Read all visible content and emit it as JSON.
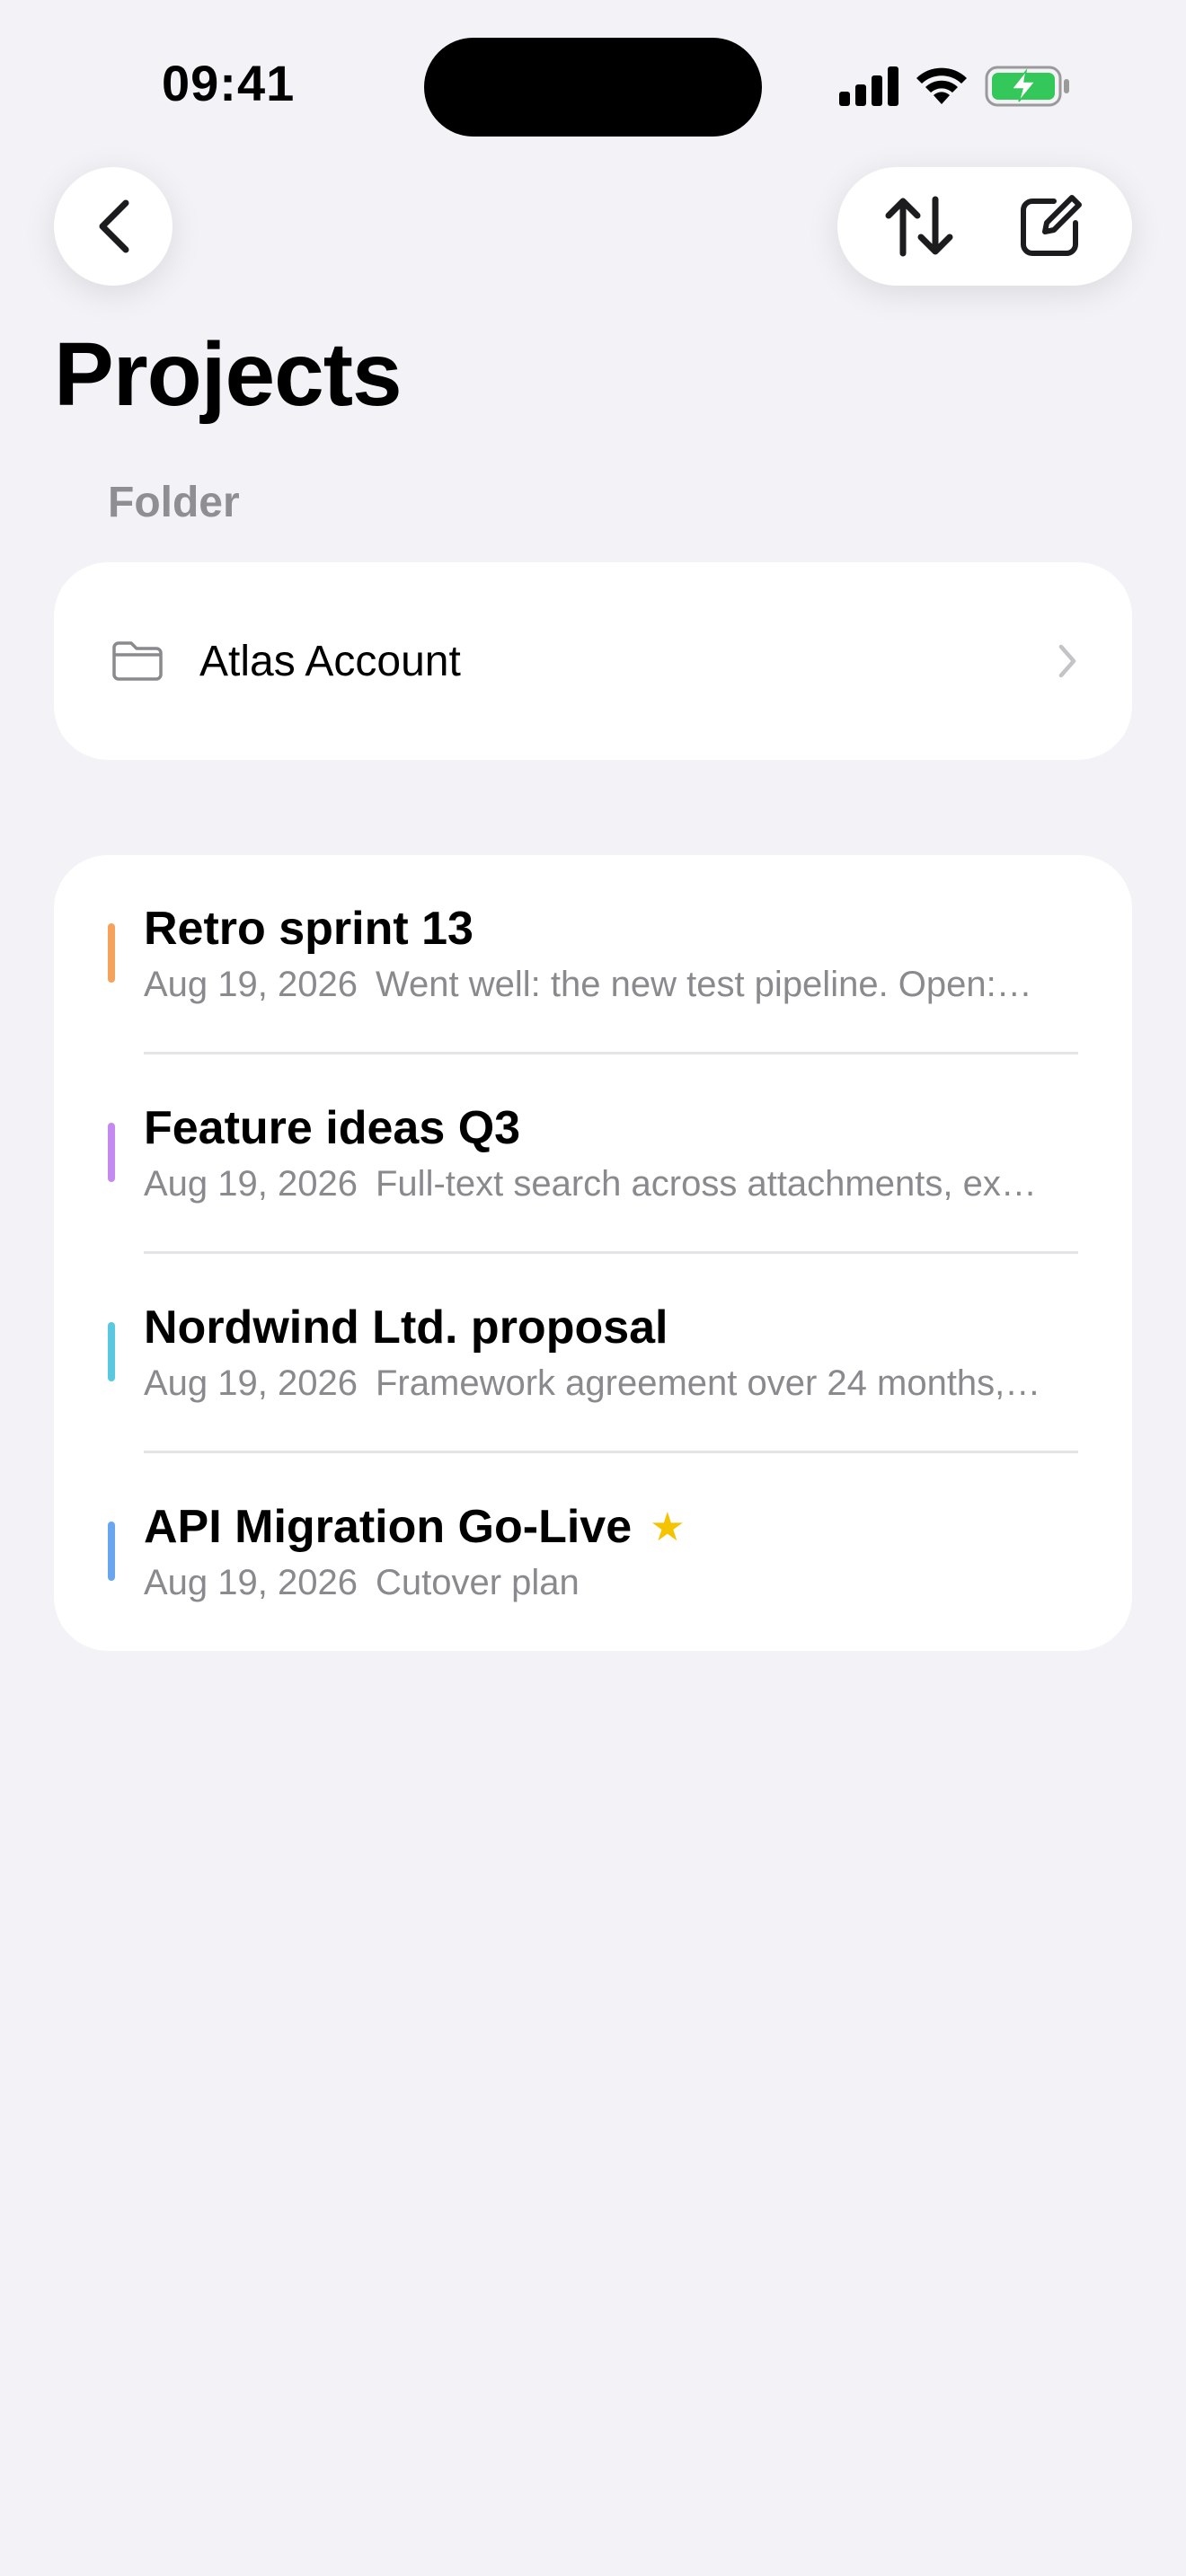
{
  "status_bar": {
    "time": "09:41"
  },
  "nav": {
    "back_icon": "chevron-left-icon",
    "sort_icon": "sort-arrows-icon",
    "compose_icon": "compose-icon"
  },
  "page": {
    "title": "Projects"
  },
  "folder_section": {
    "label": "Folder",
    "folder": {
      "icon": "folder-icon",
      "name": "Atlas Account"
    }
  },
  "notes": [
    {
      "title": "Retro sprint 13",
      "date": "Aug 19, 2026",
      "preview": "Went well: the new test pipeline. Open:…",
      "color": "#f5a25d",
      "starred": false
    },
    {
      "title": "Feature ideas Q3",
      "date": "Aug 19, 2026",
      "preview": "Full-text search across attachments, ex…",
      "color": "#c58af2",
      "starred": false
    },
    {
      "title": "Nordwind Ltd. proposal",
      "date": "Aug 19, 2026",
      "preview": "Framework agreement over 24 months,…",
      "color": "#5ac8e0",
      "starred": false
    },
    {
      "title": "API Migration Go-Live",
      "date": "Aug 19, 2026",
      "preview": "Cutover plan",
      "color": "#6aa6f0",
      "starred": true
    }
  ],
  "colors": {
    "background": "#f2f2f7",
    "card": "#ffffff",
    "star": "#f5c400",
    "battery": "#34c759"
  }
}
